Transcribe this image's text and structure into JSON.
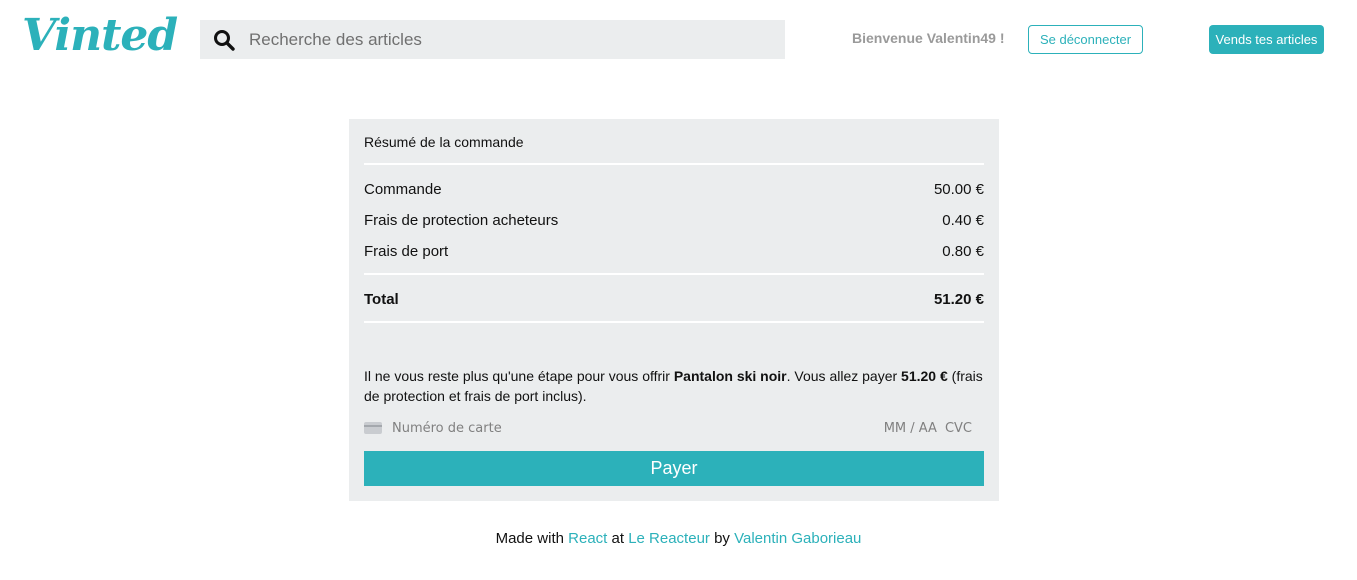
{
  "header": {
    "logo_text": "Vinted",
    "search_placeholder": "Recherche des articles",
    "welcome_text": "Bienvenue Valentin49 !",
    "logout_label": "Se déconnecter",
    "sell_label": "Vends tes articles",
    "search_icon": "search-icon"
  },
  "order": {
    "title": "Résumé de la commande",
    "lines": [
      {
        "label": "Commande",
        "value": "50.00 €"
      },
      {
        "label": "Frais de protection acheteurs",
        "value": "0.40 €"
      },
      {
        "label": "Frais de port",
        "value": "0.80 €"
      }
    ],
    "total": {
      "label": "Total",
      "value": "51.20 €"
    },
    "message": {
      "part1": "Il ne vous reste plus qu'une étape pour vous offrir ",
      "product": "Pantalon ski noir",
      "part2": ". Vous allez payer ",
      "amount": "51.20 €",
      "part3": " (frais de protection et frais de port inclus)."
    },
    "card": {
      "number_placeholder": "Numéro de carte",
      "expiry_placeholder": "MM / AA",
      "cvc_placeholder": "CVC",
      "icon": "credit-card-icon"
    },
    "pay_label": "Payer"
  },
  "footer": {
    "made_with": "Made with ",
    "react": "React",
    "at": " at ",
    "reacteur": "Le Reacteur",
    "by": " by ",
    "author": "Valentin Gaborieau"
  },
  "colors": {
    "accent": "#2cb1ba",
    "panel": "#ebedee",
    "muted": "#9a9a9a"
  }
}
